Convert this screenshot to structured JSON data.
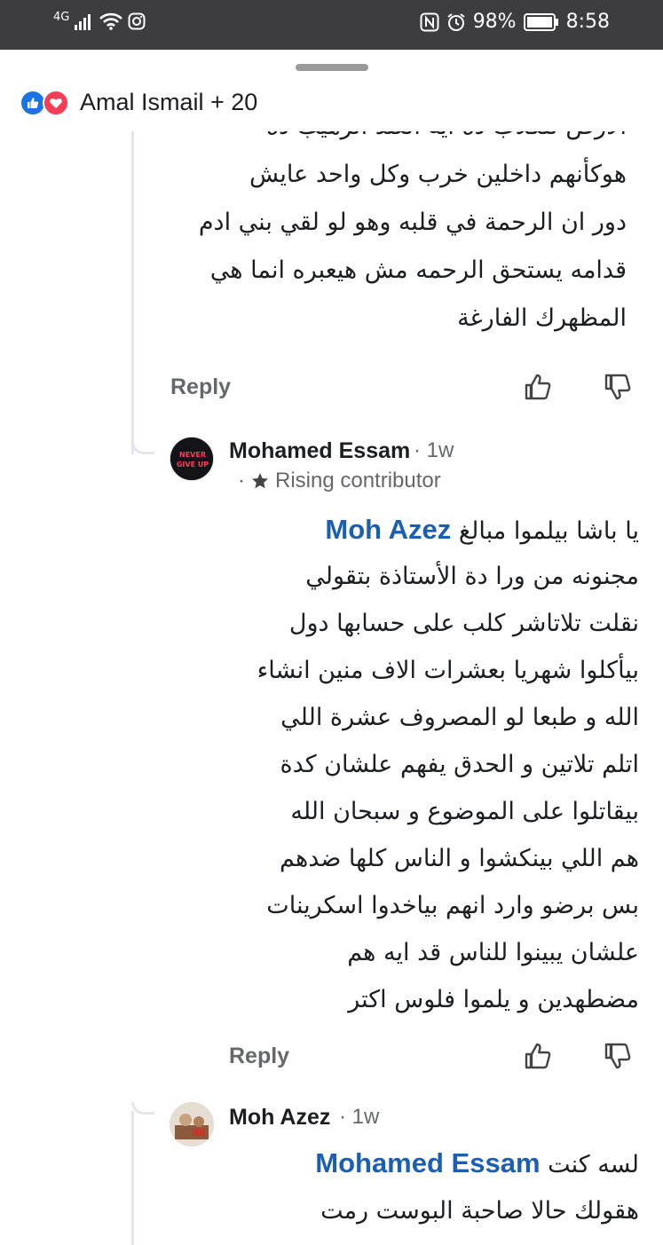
{
  "status_bar": {
    "network": "4G",
    "battery": "98%",
    "time": "8:58"
  },
  "header": {
    "reactions": [
      "like-reaction",
      "love-reaction"
    ],
    "reactors_text": "Amal Ismail + 20"
  },
  "comments": [
    {
      "id": "c1",
      "lines": [
        "الارض للكلاب ده ايه العند الرهيب ده",
        "هوكأنهم داخلين خرب وكل واحد عايش",
        "دور ان الرحمة في قلبه وهو لو لقي بني ادم",
        "قدامه يستحق الرحمه مش هيعبره انما هي",
        "المظهرك الفارغة"
      ],
      "reply_label": "Reply"
    },
    {
      "id": "c2",
      "author": "Mohamed Essam",
      "time": "1w",
      "badge": "Rising contributor",
      "mention": "Moh Azez",
      "first_line_text": "يا باشا بيلموا مبالغ",
      "lines": [
        "مجنونه من ورا دة الأستاذة بتقولي",
        "نقلت تلاتاشر كلب على حسابها دول",
        "بيأكلوا شهريا بعشرات الاف منين انشاء",
        "الله و طبعا لو المصروف عشرة اللي",
        "اتلم تلاتين و الحدق يفهم علشان كدة",
        "بيقاتلوا على الموضوع و سبحان الله",
        "هم اللي بينكشوا و الناس كلها ضدهم",
        "بس برضو وارد انهم بياخدوا اسكرينات",
        "علشان يبينوا للناس قد ايه هم",
        "مضطهدين و يلموا فلوس اكتر"
      ],
      "reply_label": "Reply",
      "avatar_text": "NEVER GIVE UP"
    },
    {
      "id": "c3",
      "author": "Moh Azez",
      "time": "1w",
      "mention": "Mohamed Essam",
      "first_line_text": "لسه كنت",
      "lines": [
        "هقولك حالا صاحبة البوست رمت"
      ]
    }
  ],
  "colors": {
    "status_bar_bg": "#3d3d3f",
    "mention": "#1a5fb4",
    "muted": "#65676b",
    "like_blue": "#1b74e4",
    "love_red": "#f33e58"
  }
}
